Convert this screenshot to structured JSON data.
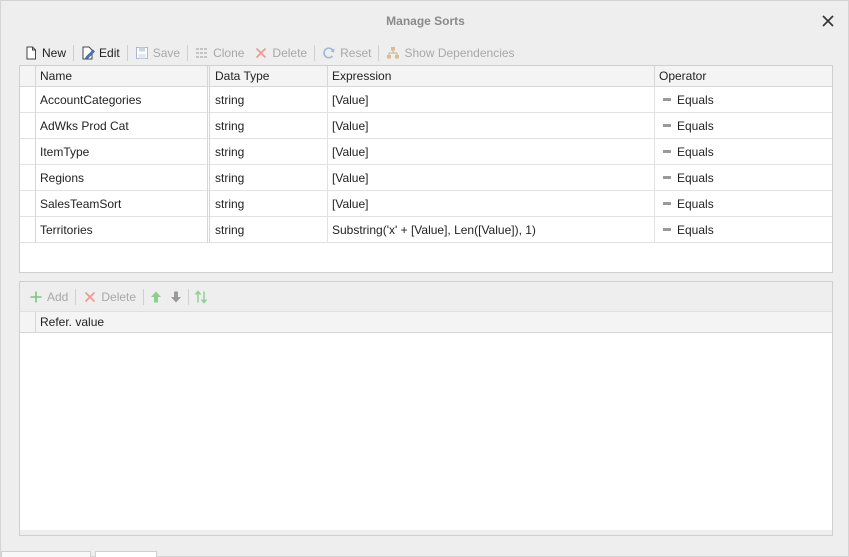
{
  "dialog": {
    "title": "Manage Sorts"
  },
  "toolbar": {
    "new_label": "New",
    "edit_label": "Edit",
    "save_label": "Save",
    "clone_label": "Clone",
    "delete_label": "Delete",
    "reset_label": "Reset",
    "show_dependencies_label": "Show Dependencies"
  },
  "grid": {
    "columns": {
      "name": "Name",
      "data_type": "Data Type",
      "expression": "Expression",
      "operator": "Operator"
    },
    "rows": [
      {
        "name": "AccountCategories",
        "data_type": "string",
        "expression": "[Value]",
        "operator": "Equals"
      },
      {
        "name": "AdWks Prod Cat",
        "data_type": "string",
        "expression": "[Value]",
        "operator": "Equals"
      },
      {
        "name": "ItemType",
        "data_type": "string",
        "expression": "[Value]",
        "operator": "Equals"
      },
      {
        "name": "Regions",
        "data_type": "string",
        "expression": "[Value]",
        "operator": "Equals"
      },
      {
        "name": "SalesTeamSort",
        "data_type": "string",
        "expression": "[Value]",
        "operator": "Equals"
      },
      {
        "name": "Territories",
        "data_type": "string",
        "expression": "Substring('x' + [Value], Len([Value]), 1)",
        "operator": "Equals"
      }
    ]
  },
  "lower": {
    "add_label": "Add",
    "delete_label": "Delete",
    "column_header": "Refer. value"
  },
  "colors": {
    "accent_blue": "#4a7bbf",
    "delete_red": "#e07b6b",
    "add_green": "#7cc47c",
    "arrow_green": "#8ccf8c",
    "disabled_gray": "#a8a8a8"
  }
}
